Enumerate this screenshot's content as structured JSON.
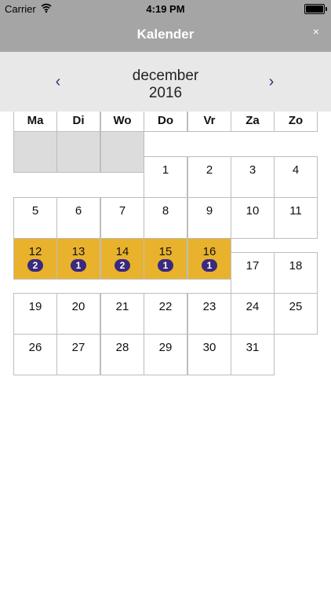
{
  "status_bar": {
    "carrier": "Carrier",
    "time": "4:19 PM"
  },
  "nav": {
    "title": "Kalender",
    "close": "×"
  },
  "month_header": {
    "prev": "‹",
    "next": "›",
    "month": "december",
    "year": "2016"
  },
  "weekdays": [
    "Ma",
    "Di",
    "Wo",
    "Do",
    "Vr",
    "Za",
    "Zo"
  ],
  "days": {
    "d1": "1",
    "d2": "2",
    "d3": "3",
    "d4": "4",
    "d5": "5",
    "d6": "6",
    "d7": "7",
    "d8": "8",
    "d9": "9",
    "d10": "10",
    "d11": "11",
    "d12": "12",
    "d13": "13",
    "d14": "14",
    "d15": "15",
    "d16": "16",
    "d17": "17",
    "d18": "18",
    "d19": "19",
    "d20": "20",
    "d21": "21",
    "d22": "22",
    "d23": "23",
    "d24": "24",
    "d25": "25",
    "d26": "26",
    "d27": "27",
    "d28": "28",
    "d29": "29",
    "d30": "30",
    "d31": "31"
  },
  "badges": {
    "d12": "2",
    "d13": "1",
    "d14": "2",
    "d15": "1",
    "d16": "1"
  },
  "colors": {
    "nav": "#a5a5a5",
    "highlight": "#e9b22c",
    "badge": "#3a2a7e",
    "empty": "#dcdcdc"
  }
}
